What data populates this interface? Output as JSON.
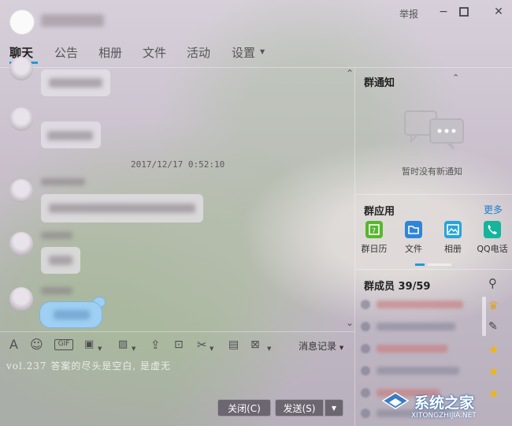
{
  "titlebar": {
    "report_label": "举报",
    "minimize_glyph": "−",
    "maximize_glyph": "□",
    "close_glyph": "✕"
  },
  "tabs": [
    {
      "label": "聊天",
      "active": true
    },
    {
      "label": "公告"
    },
    {
      "label": "相册"
    },
    {
      "label": "文件"
    },
    {
      "label": "活动"
    },
    {
      "label": "设置"
    }
  ],
  "chat": {
    "timestamp": "2017/12/17 0:52:10",
    "scroll_up_glyph": "⌃",
    "scroll_down_glyph": "⌄"
  },
  "toolbar": {
    "font_icon": "A",
    "gif_label": "GIF",
    "history_label": "消息记录"
  },
  "input": {
    "text": "vol.237 答案的尽头是空白, 是虚无"
  },
  "buttons": {
    "close_label": "关闭(C)",
    "send_label": "发送(S)"
  },
  "right_panel": {
    "notice_title": "群通知",
    "notice_empty": "暂时没有新通知",
    "apps_title": "群应用",
    "more_label": "更多",
    "apps": [
      {
        "label": "群日历",
        "color": "#57b72f",
        "icon": "calendar-icon"
      },
      {
        "label": "文件",
        "color": "#2f86d8",
        "icon": "folder-icon"
      },
      {
        "label": "相册",
        "color": "#2aa3d9",
        "icon": "photo-icon"
      },
      {
        "label": "QQ电话",
        "color": "#14b59a",
        "icon": "phone-icon"
      }
    ],
    "members_title": "群成员 39/59"
  },
  "watermark": {
    "text": "系统之家",
    "url": "XITONGZHIJIA.NET"
  }
}
